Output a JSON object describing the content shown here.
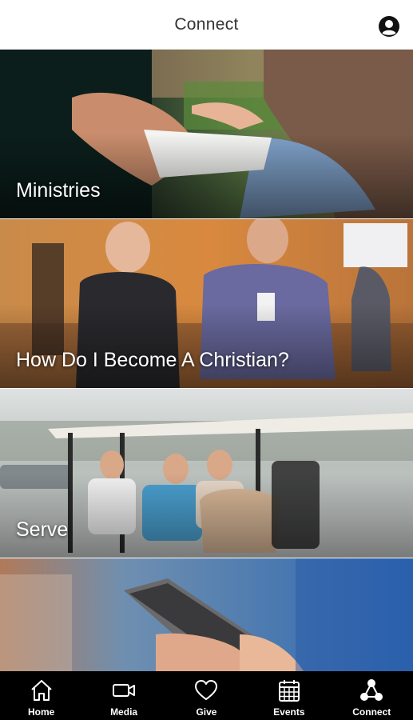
{
  "header": {
    "title": "Connect",
    "profile_icon": "user-circle-icon"
  },
  "cards": [
    {
      "label": "Ministries",
      "image": "people-sharing-book-photo"
    },
    {
      "label": "How Do I Become A Christian?",
      "image": "two-men-talking-lobby-photo"
    },
    {
      "label": "Serve",
      "image": "golf-cart-volunteers-photo"
    },
    {
      "label": "",
      "image": "hand-holding-phone-photo"
    }
  ],
  "tabs": [
    {
      "label": "Home",
      "icon": "home-icon"
    },
    {
      "label": "Media",
      "icon": "video-camera-icon"
    },
    {
      "label": "Give",
      "icon": "heart-icon"
    },
    {
      "label": "Events",
      "icon": "calendar-icon"
    },
    {
      "label": "Connect",
      "icon": "connect-network-icon"
    }
  ],
  "colors": {
    "header_bg": "#ffffff",
    "tabbar_bg": "#000000",
    "label_text": "#ffffff",
    "title_text": "#333333"
  }
}
